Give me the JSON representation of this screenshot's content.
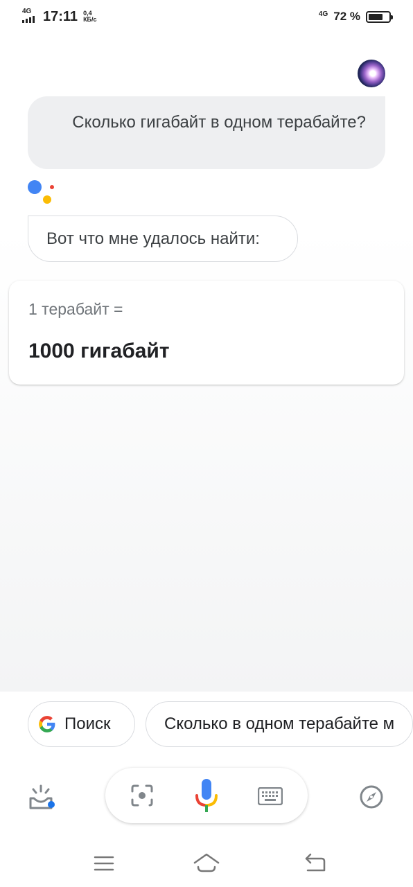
{
  "status_bar": {
    "network_left": "4G",
    "time": "17:11",
    "speed_value": "0,4",
    "speed_unit": "КБ/с",
    "network_right": "4G",
    "battery_percent": "72 %",
    "battery_level": 0.72
  },
  "conversation": {
    "user_query": "Сколько гигабайт в одном терабайте?",
    "assistant_reply": "Вот что мне удалось найти:"
  },
  "result_card": {
    "label": "1 терабайт =",
    "value": "1000 гигабайт"
  },
  "suggestions": {
    "search_chip": "Поиск",
    "query_chip": "Сколько в одном терабайте м"
  },
  "icons": {
    "updates": "updates-icon",
    "lens": "lens-icon",
    "mic": "mic-icon",
    "keyboard": "keyboard-icon",
    "explore": "compass-icon",
    "nav_menu": "menu-icon",
    "nav_home": "home-icon",
    "nav_back": "back-icon"
  },
  "colors": {
    "google_blue": "#4285f4",
    "google_red": "#ea4335",
    "google_yellow": "#fbbc04",
    "google_green": "#34a853",
    "accent_blue": "#1a73e8"
  }
}
